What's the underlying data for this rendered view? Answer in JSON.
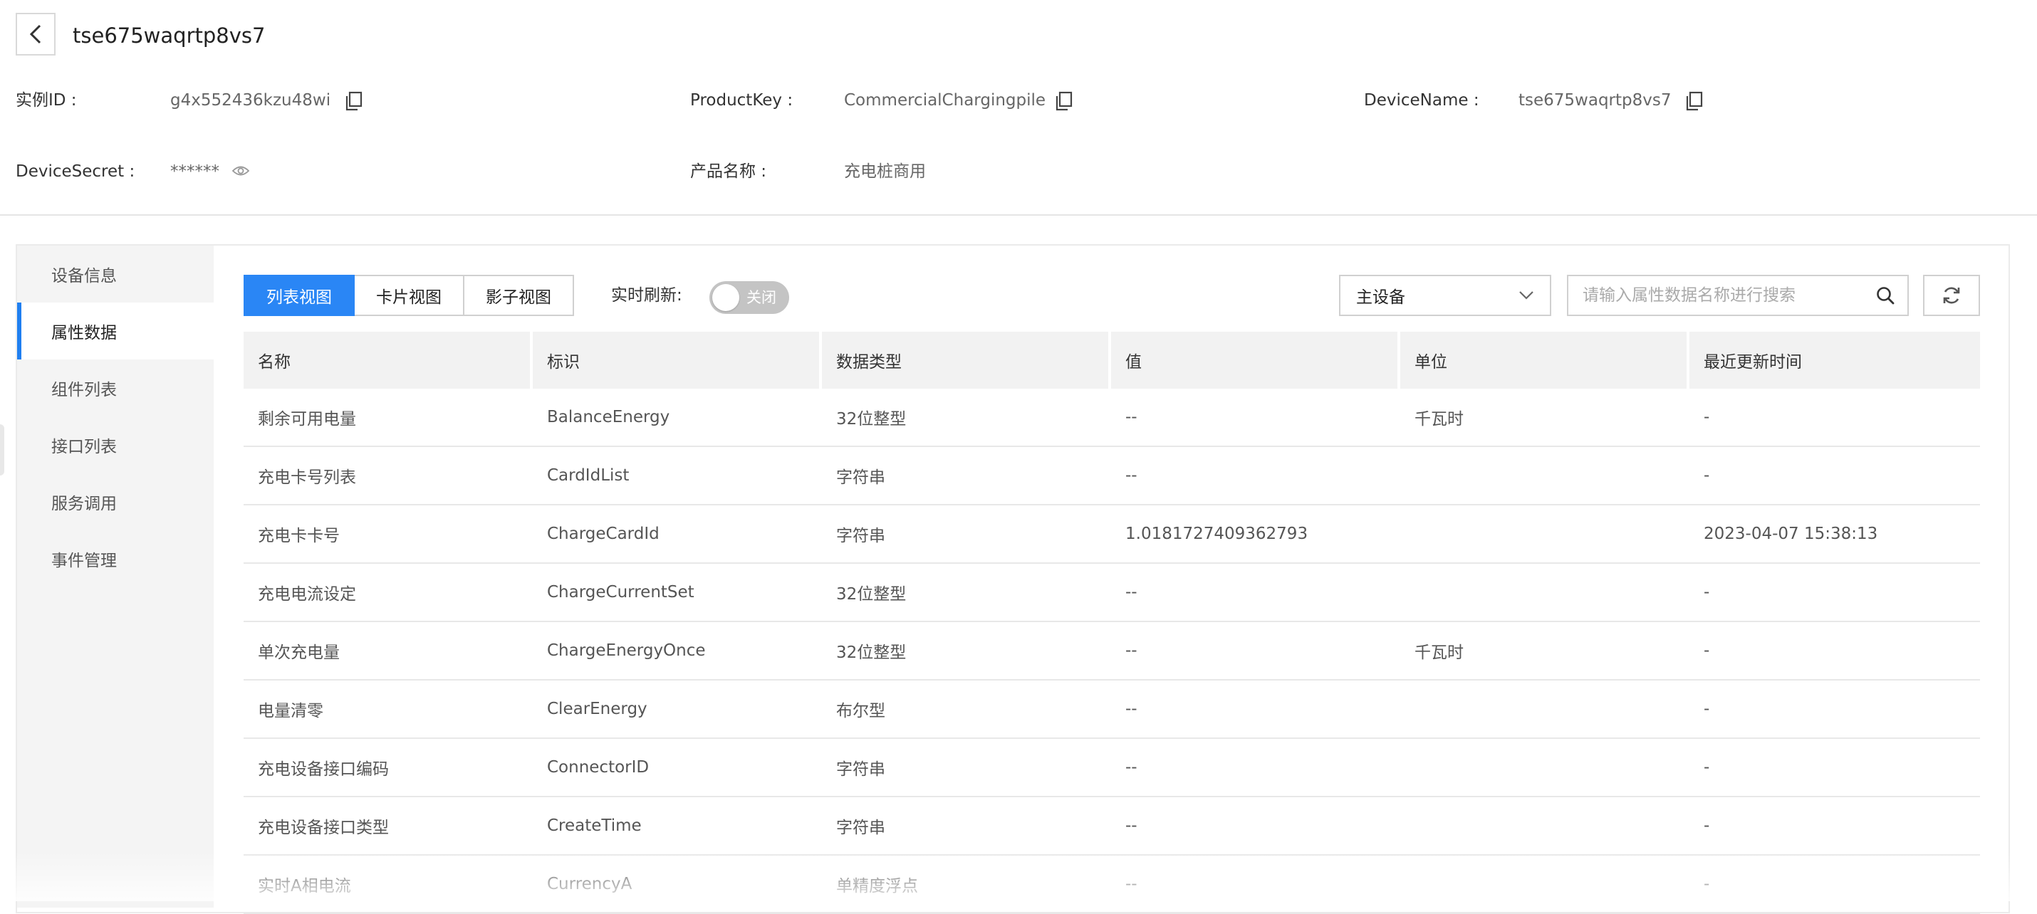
{
  "header": {
    "device_title": "tse675waqrtp8vs7",
    "fields": [
      {
        "label": "实例ID :",
        "value": "g4x552436kzu48wi"
      },
      {
        "label": "ProductKey :",
        "value": "CommercialChargingpile"
      },
      {
        "label": "DeviceName :",
        "value": "tse675waqrtp8vs7"
      },
      {
        "label": "DeviceSecret :",
        "value": "******"
      },
      {
        "label": "产品名称 :",
        "value": "充电桩商用"
      }
    ]
  },
  "sidebar": {
    "items": [
      {
        "label": "设备信息",
        "active": false
      },
      {
        "label": "属性数据",
        "active": true
      },
      {
        "label": "组件列表",
        "active": false
      },
      {
        "label": "接口列表",
        "active": false
      },
      {
        "label": "服务调用",
        "active": false
      },
      {
        "label": "事件管理",
        "active": false
      }
    ]
  },
  "toolbar": {
    "tabs": [
      {
        "label": "列表视图",
        "active": true
      },
      {
        "label": "卡片视图",
        "active": false
      },
      {
        "label": "影子视图",
        "active": false
      }
    ],
    "refresh_label": "实时刷新:",
    "toggle_text": "关闭",
    "select_value": "主设备",
    "search_placeholder": "请输入属性数据名称进行搜索"
  },
  "table": {
    "columns": [
      "名称",
      "标识",
      "数据类型",
      "值",
      "单位",
      "最近更新时间"
    ],
    "rows": [
      [
        "剩余可用电量",
        "BalanceEnergy",
        "32位整型",
        "--",
        "千瓦时",
        "-"
      ],
      [
        "充电卡号列表",
        "CardIdList",
        "字符串",
        "--",
        "",
        "-"
      ],
      [
        "充电卡卡号",
        "ChargeCardId",
        "字符串",
        "1.0181727409362793",
        "",
        "2023-04-07 15:38:13"
      ],
      [
        "充电电流设定",
        "ChargeCurrentSet",
        "32位整型",
        "--",
        "",
        "-"
      ],
      [
        "单次充电量",
        "ChargeEnergyOnce",
        "32位整型",
        "--",
        "千瓦时",
        "-"
      ],
      [
        "电量清零",
        "ClearEnergy",
        "布尔型",
        "--",
        "",
        "-"
      ],
      [
        "充电设备接口编码",
        "ConnectorID",
        "字符串",
        "--",
        "",
        "-"
      ],
      [
        "充电设备接口类型",
        "CreateTime",
        "字符串",
        "--",
        "",
        "-"
      ],
      [
        "实时A相电流",
        "CurrencyA",
        "单精度浮点",
        "--",
        "",
        "-"
      ]
    ]
  },
  "colors": {
    "accent": "#2a86f5",
    "toggle_off": "#c4c4c4",
    "header_bg": "#f2f2f2",
    "sidebar_bg": "#f4f4f4"
  }
}
